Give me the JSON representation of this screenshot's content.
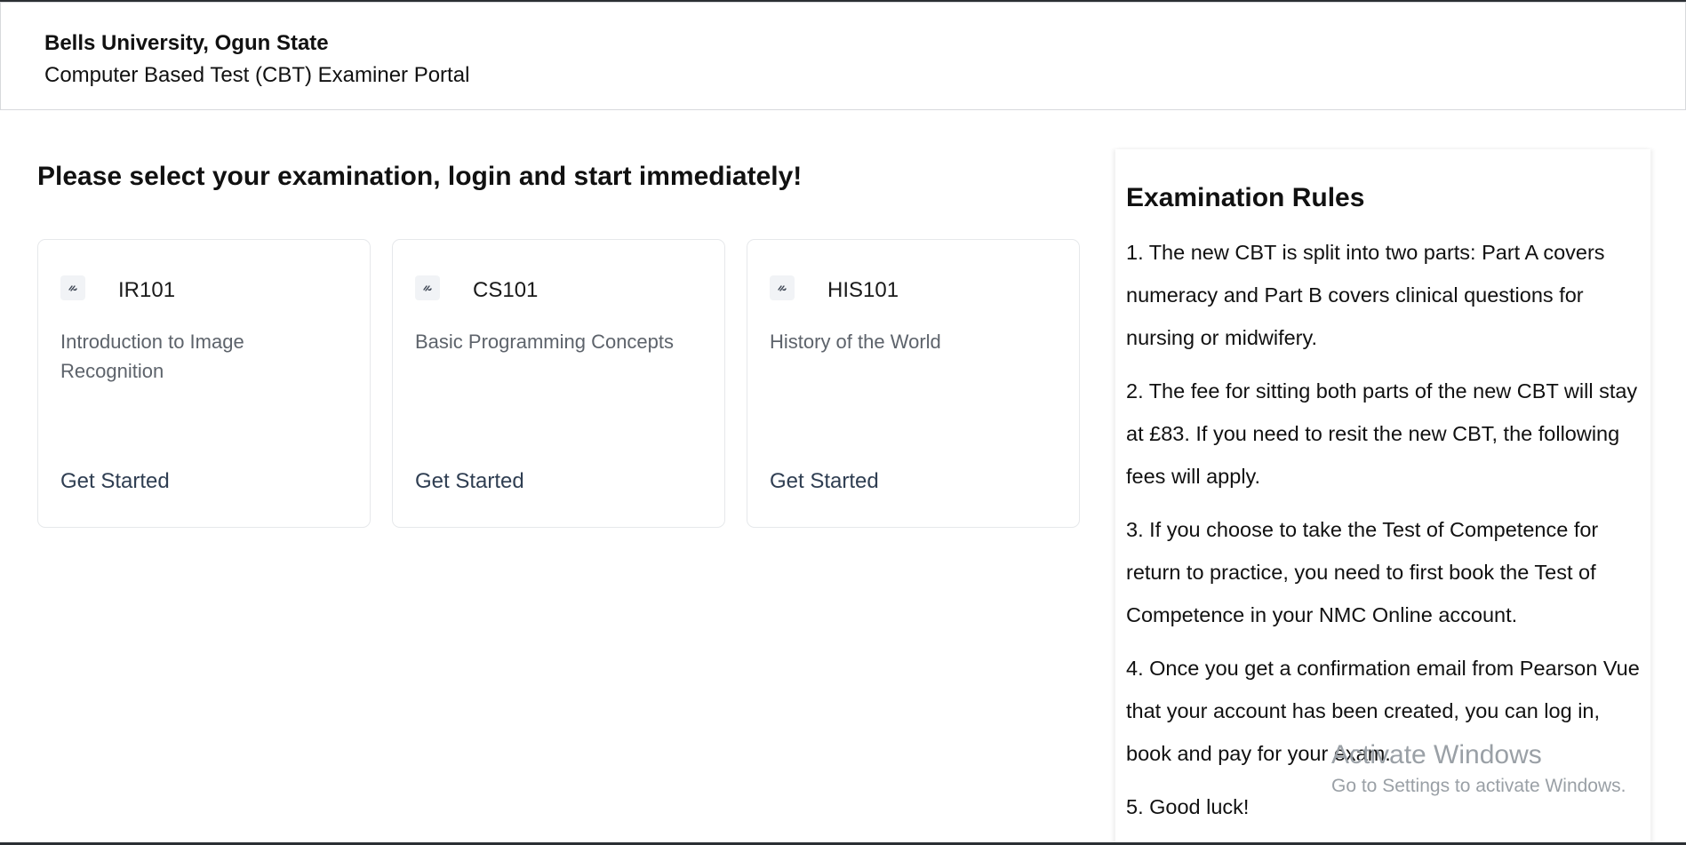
{
  "header": {
    "org_name": "Bells University, Ogun State",
    "portal_name": "Computer Based Test (CBT) Examiner Portal"
  },
  "main": {
    "title": "Please select your examination, login and start immediately!",
    "exams": [
      {
        "code": "IR101",
        "description": "Introduction to Image Recognition",
        "cta": "Get Started",
        "icon": "link-icon"
      },
      {
        "code": "CS101",
        "description": "Basic Programming Concepts",
        "cta": "Get Started",
        "icon": "link-icon"
      },
      {
        "code": "HIS101",
        "description": "History of the World",
        "cta": "Get Started",
        "icon": "link-icon"
      }
    ]
  },
  "rules": {
    "title": "Examination Rules",
    "items": [
      "1. The new CBT is split into two parts: Part A covers numeracy and Part B covers clinical questions for nursing or midwifery.",
      "2. The fee for sitting both parts of the new CBT will stay at £83. If you need to resit the new CBT, the following fees will apply.",
      "3. If you choose to take the Test of Competence for return to practice, you need to first book the Test of Competence in your NMC Online account.",
      "4. Once you get a confirmation email from Pearson Vue that your account has been created, you can log in, book and pay for your exam.",
      "5. Good luck!"
    ]
  },
  "watermark": {
    "title": "Activate Windows",
    "subtitle": "Go to Settings to activate Windows."
  }
}
